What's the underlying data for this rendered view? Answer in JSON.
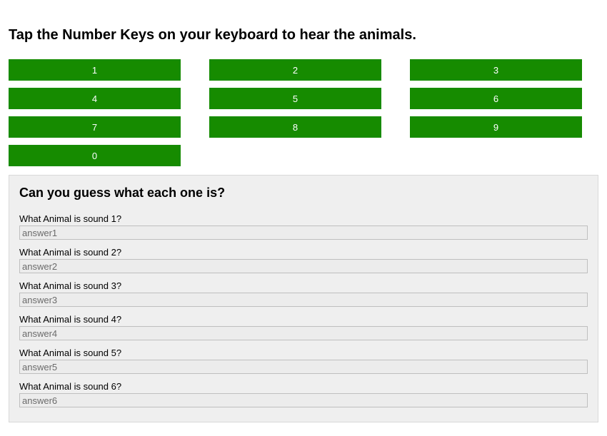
{
  "header": {
    "title": "Tap the Number Keys on your keyboard to hear the animals."
  },
  "buttons": [
    {
      "label": "1"
    },
    {
      "label": "2"
    },
    {
      "label": "3"
    },
    {
      "label": "4"
    },
    {
      "label": "5"
    },
    {
      "label": "6"
    },
    {
      "label": "7"
    },
    {
      "label": "8"
    },
    {
      "label": "9"
    },
    {
      "label": "0"
    }
  ],
  "guess": {
    "title": "Can you guess what each one is?",
    "questions": [
      {
        "label": "What Animal is sound 1?",
        "placeholder": "answer1"
      },
      {
        "label": "What Animal is sound 2?",
        "placeholder": "answer2"
      },
      {
        "label": "What Animal is sound 3?",
        "placeholder": "answer3"
      },
      {
        "label": "What Animal is sound 4?",
        "placeholder": "answer4"
      },
      {
        "label": "What Animal is sound 5?",
        "placeholder": "answer5"
      },
      {
        "label": "What Animal is sound 6?",
        "placeholder": "answer6"
      }
    ]
  }
}
